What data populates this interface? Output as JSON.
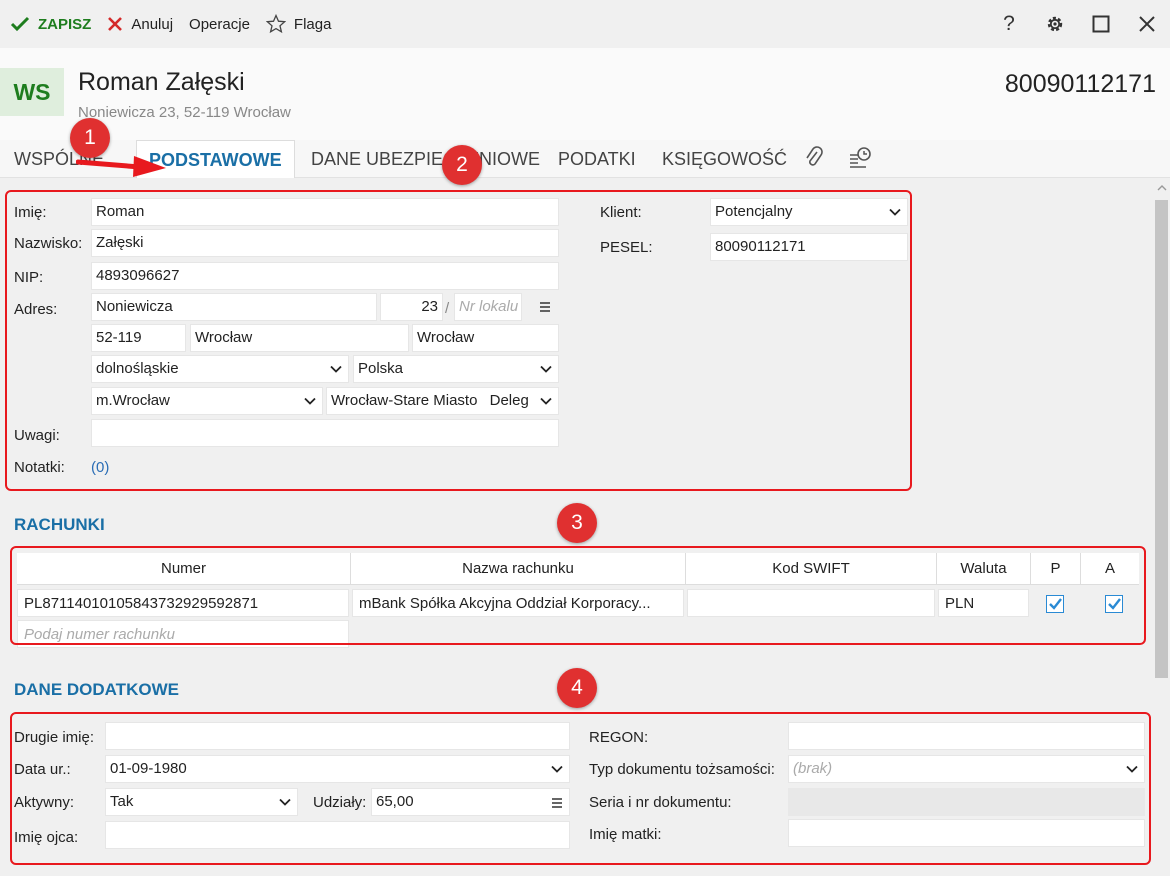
{
  "toolbar": {
    "save_label": "ZAPISZ",
    "cancel_label": "Anuluj",
    "operations_label": "Operacje",
    "flag_label": "Flaga",
    "help_label": "?"
  },
  "header": {
    "initials": "WS",
    "name": "Roman Załęski",
    "address": "Noniewicza 23, 52-119 Wrocław",
    "id_number": "80090112171"
  },
  "tabs": {
    "common": "WSPÓLNE",
    "basic": "PODSTAWOWE",
    "insurance": "DANE UBEZPIECZENIOWE",
    "taxes": "PODATKI",
    "accounting": "KSIĘGOWOŚĆ"
  },
  "basic": {
    "first_name_label": "Imię:",
    "first_name": "Roman",
    "last_name_label": "Nazwisko:",
    "last_name": "Załęski",
    "nip_label": "NIP:",
    "nip": "4893096627",
    "address_label": "Adres:",
    "street": "Noniewicza",
    "house_no": "23",
    "slash": "/",
    "flat_placeholder": "Nr lokalu",
    "postal_code": "52-119",
    "city": "Wrocław",
    "post_office": "Wrocław",
    "province": "dolnośląskie",
    "country": "Polska",
    "county": "m.Wrocław",
    "commune": "Wrocław-Stare Miasto",
    "tax_office_short": "Deleg",
    "notes_label": "Uwagi:",
    "notes": "",
    "remarks_label": "Notatki:",
    "remarks_count": "(0)",
    "client_label": "Klient:",
    "client": "Potencjalny",
    "pesel_label": "PESEL:",
    "pesel": "80090112171"
  },
  "accounts": {
    "title": "RACHUNKI",
    "columns": [
      "Numer",
      "Nazwa rachunku",
      "Kod SWIFT",
      "Waluta",
      "P",
      "A"
    ],
    "rows": [
      {
        "number": "PL87114010105843732929592871",
        "name": "mBank Spółka Akcyjna Oddział Korporacy...",
        "swift": "",
        "currency": "PLN",
        "p": true,
        "a": true
      }
    ],
    "new_placeholder": "Podaj numer rachunku"
  },
  "additional": {
    "title": "DANE DODATKOWE",
    "second_name_label": "Drugie imię:",
    "second_name": "",
    "birth_label": "Data ur.:",
    "birth_date": "01-09-1980",
    "active_label": "Aktywny:",
    "active": "Tak",
    "shares_label": "Udziały:",
    "shares": "65,00",
    "father_label": "Imię ojca:",
    "father": "",
    "regon_label": "REGON:",
    "regon": "",
    "id_doc_type_label": "Typ dokumentu tożsamości:",
    "id_doc_type": "(brak)",
    "id_doc_no_label": "Seria i nr dokumentu:",
    "id_doc_no": "",
    "mother_label": "Imię matki:",
    "mother": ""
  },
  "annotations": [
    "1",
    "2",
    "3",
    "4"
  ],
  "colors": {
    "accent": "#1a6fa6",
    "save_green": "#1e7d1e",
    "cancel_red": "#d42a2a",
    "annotation_red": "#e8191e"
  }
}
